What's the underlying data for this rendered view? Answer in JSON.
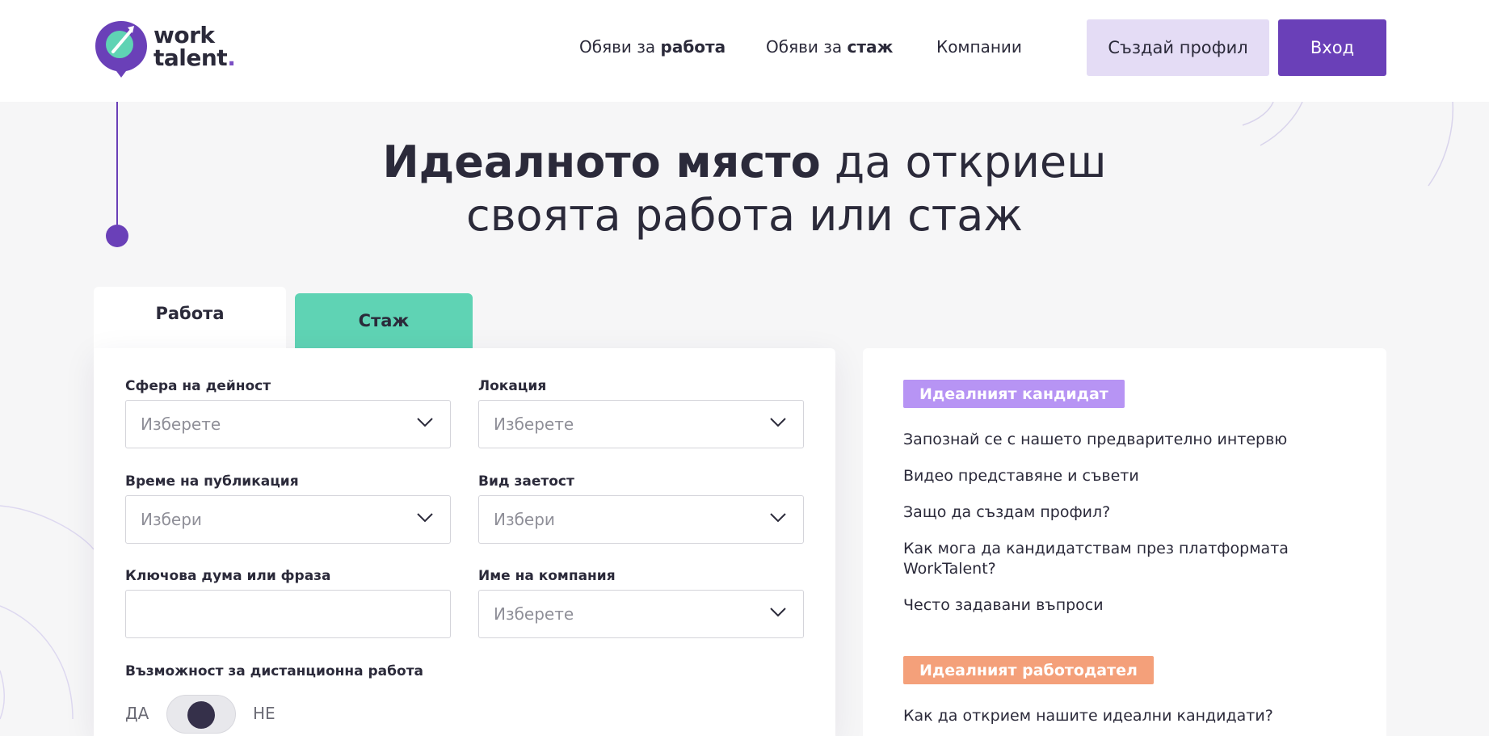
{
  "brand": {
    "line1": "work",
    "line2": "talent",
    "dot": "."
  },
  "nav": [
    {
      "prefix": "Обяви за",
      "strong": "работа"
    },
    {
      "prefix": "Обяви за",
      "strong": "стаж"
    },
    {
      "prefix": "Компании",
      "strong": ""
    }
  ],
  "header_buttons": {
    "create_profile": "Създай профил",
    "login": "Вход"
  },
  "hero": {
    "strong": "Идеалното място",
    "rest_line1": " да откриеш",
    "line2": "своята работа или стаж"
  },
  "tabs": {
    "work": "Работа",
    "internship": "Стаж"
  },
  "form": {
    "field_area": {
      "label": "Сфера на дейност",
      "placeholder": "Изберете"
    },
    "field_location": {
      "label": "Локация",
      "placeholder": "Изберете"
    },
    "field_posted": {
      "label": "Време на публикация",
      "placeholder": "Избери"
    },
    "field_employment": {
      "label": "Вид заетост",
      "placeholder": "Избери"
    },
    "field_keyword": {
      "label": "Ключова дума или фраза",
      "value": ""
    },
    "field_company": {
      "label": "Име на компания",
      "placeholder": "Изберете"
    },
    "remote": {
      "label": "Възможност за дистанционна работа",
      "yes": "ДА",
      "no": "НЕ"
    }
  },
  "side": {
    "candidate_badge": "Идеалният кандидат",
    "candidate_links": [
      "Запознай се с нашето предварително интервю",
      "Видео представяне и съвети",
      "Защо да създам профил?",
      "Как мога да кандидатствам през платформата WorkTalent?",
      "Често задавани въпроси"
    ],
    "employer_badge": "Идеалният работодател",
    "employer_links": [
      "Как да открием нашите идеални кандидати?"
    ]
  },
  "colors": {
    "brand_purple": "#6a40b8",
    "light_purple": "#e4dcf5",
    "teal": "#5fd3b4",
    "candidate_badge": "#b794f4",
    "employer_badge": "#f4a07a"
  }
}
